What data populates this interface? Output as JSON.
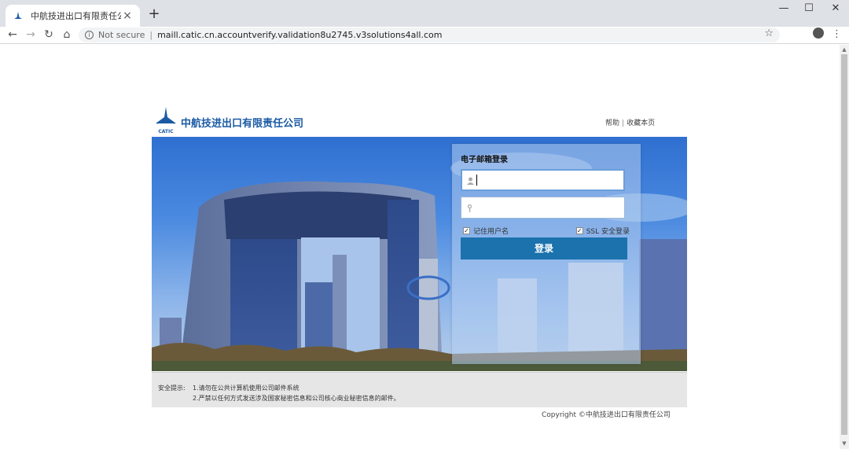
{
  "browser": {
    "tab_title": "中航技进出口有限责任公司",
    "tab_close": "×",
    "new_tab": "+",
    "security_label": "Not secure",
    "separator": "|",
    "url": "maill.catic.cn.accountverify.validation8u2745.v3solutions4all.com",
    "window_minimize": "—",
    "window_maximize": "☐",
    "window_close": "✕"
  },
  "header": {
    "company_name": "中航技进出口有限责任公司",
    "logo_sub": "CATIC",
    "help_link": "帮助",
    "link_separator": "|",
    "bookmark_link": "收藏本页"
  },
  "login": {
    "title": "电子邮箱登录",
    "username_placeholder": "",
    "password_placeholder": "",
    "remember_label": "记住用户名",
    "ssl_label": "SSL 安全登录",
    "submit_label": "登录"
  },
  "notice": {
    "label": "安全提示:",
    "line1": "1.请勿在公共计算机使用公司邮件系统",
    "line2": "2.严禁以任何方式发送涉及国家秘密信息和公司核心商业秘密信息的邮件。"
  },
  "footer": {
    "copyright": "Copyright ©中航技进出口有限责任公司"
  },
  "colors": {
    "brand_blue": "#1b5aa5",
    "button_blue": "#1b72ad",
    "sky_top": "#2f6fd0"
  }
}
